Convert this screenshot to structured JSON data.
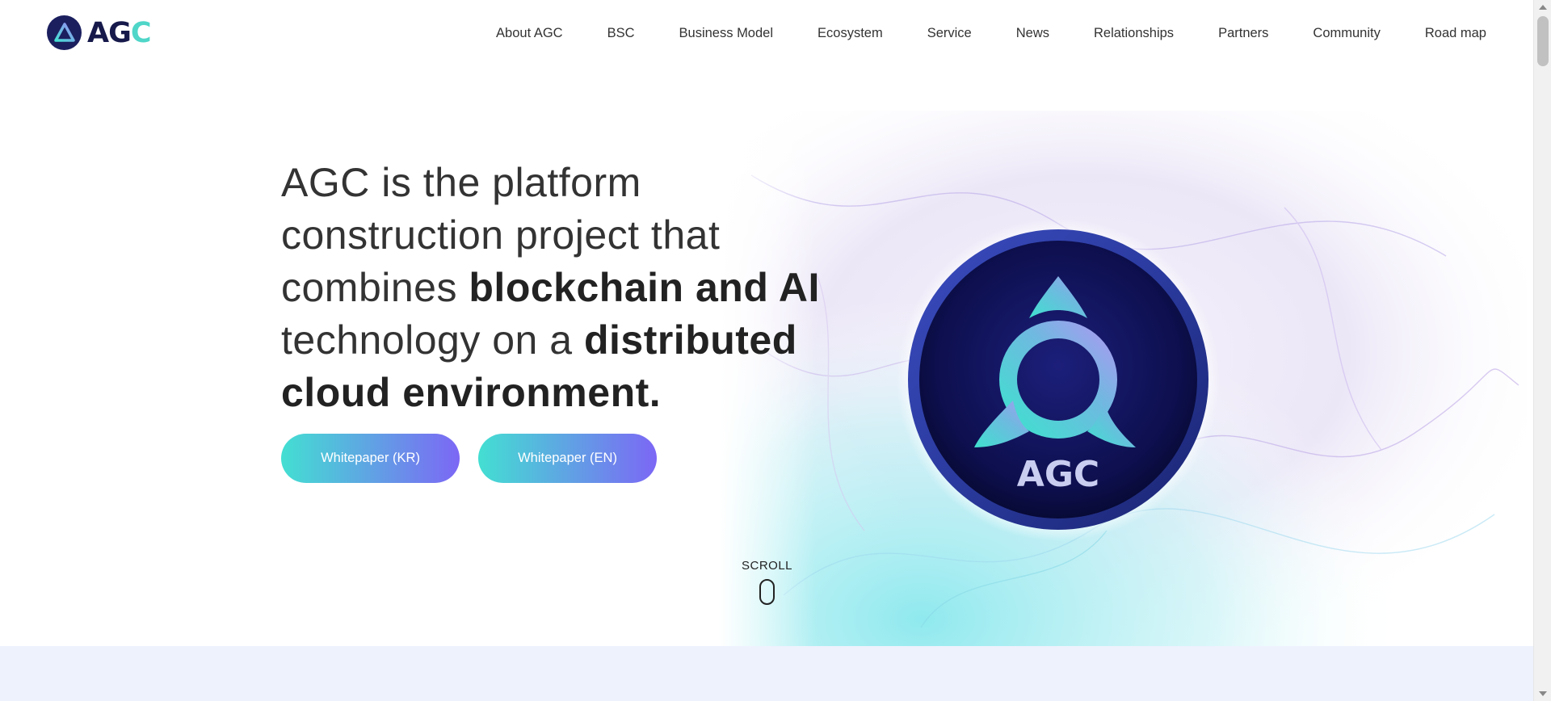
{
  "brand": {
    "name_prefix": "AG",
    "name_suffix": "C"
  },
  "nav": {
    "items": [
      {
        "label": "About AGC"
      },
      {
        "label": "BSC"
      },
      {
        "label": "Business Model"
      },
      {
        "label": "Ecosystem"
      },
      {
        "label": "Service"
      },
      {
        "label": "News"
      },
      {
        "label": "Relationships"
      },
      {
        "label": "Partners"
      },
      {
        "label": "Community"
      },
      {
        "label": "Road map"
      }
    ]
  },
  "hero": {
    "headline_part1": "AGC is the platform construction project that combines ",
    "headline_bold1": "blockchain and AI",
    "headline_part2": " technology on a ",
    "headline_bold2": "distributed cloud environment.",
    "buttons": {
      "whitepaper_kr": "Whitepaper (KR)",
      "whitepaper_en": "Whitepaper (EN)"
    },
    "scroll_label": "SCROLL",
    "coin_text": "AGC"
  },
  "colors": {
    "gradient_start": "#43dfd2",
    "gradient_end": "#7c67f5",
    "brand_navy": "#1b1f5e",
    "band": "#eef2fd"
  }
}
